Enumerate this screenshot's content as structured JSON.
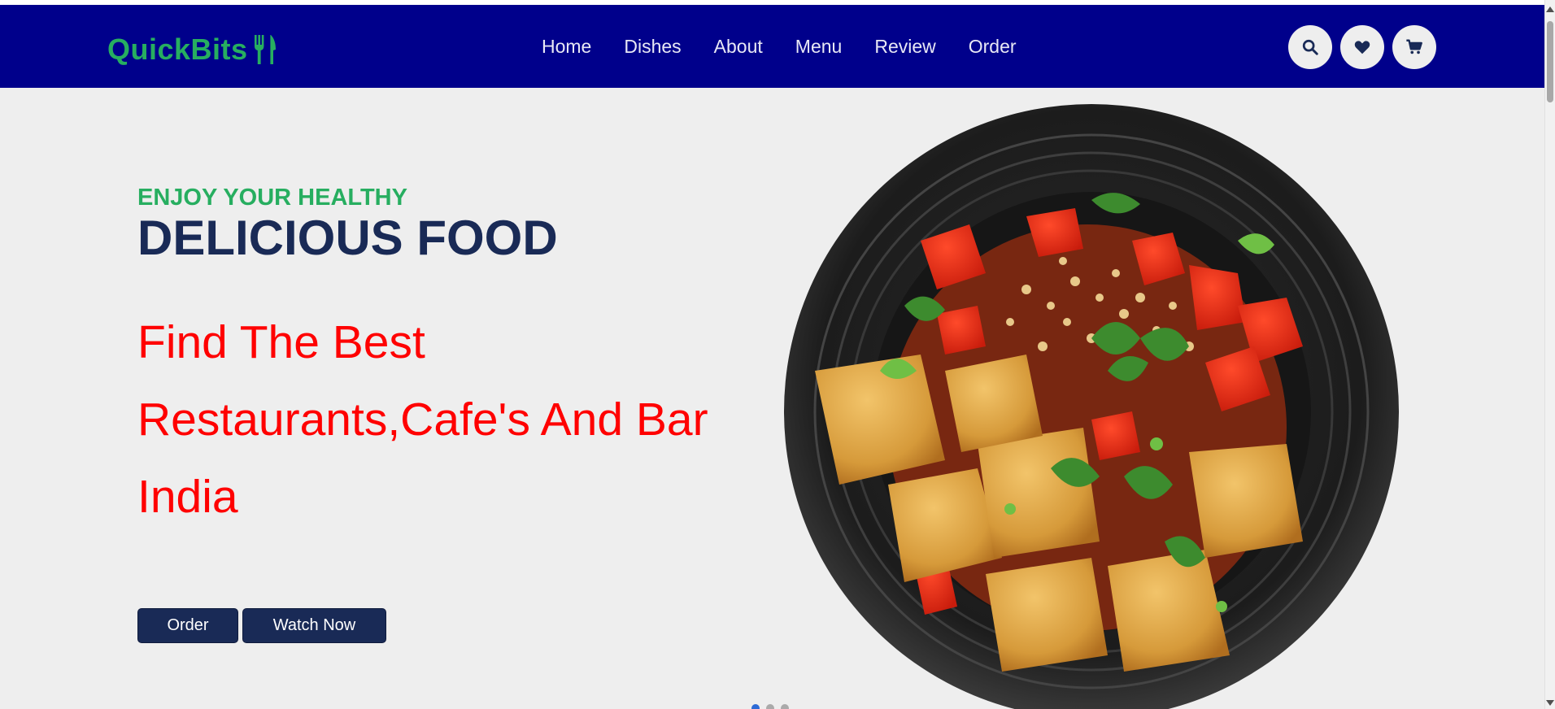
{
  "header": {
    "logo_text": "QuickBits",
    "logo_icon": "utensils-icon",
    "nav": [
      {
        "label": "Home"
      },
      {
        "label": "Dishes"
      },
      {
        "label": "About"
      },
      {
        "label": "Menu"
      },
      {
        "label": "Review"
      },
      {
        "label": "Order"
      }
    ],
    "icons": [
      "search-icon",
      "heart-icon",
      "cart-icon"
    ]
  },
  "hero": {
    "subtitle": "ENJOY YOUR HEALTHY",
    "title": "DELICIOUS FOOD",
    "description": "Find The Best Restaurants,Cafe's And Bar India",
    "buttons": {
      "order": "Order",
      "watch": "Watch Now"
    },
    "image": "plate-of-paneer-chili-dish",
    "slider": {
      "count": 3,
      "active": 1
    }
  },
  "colors": {
    "nav_bg": "#00008b",
    "logo": "#27ae60",
    "accent_green": "#27ae60",
    "title": "#192a56",
    "description": "#ff0000",
    "button_bg": "#192a56",
    "page_bg": "#eeeeee"
  }
}
